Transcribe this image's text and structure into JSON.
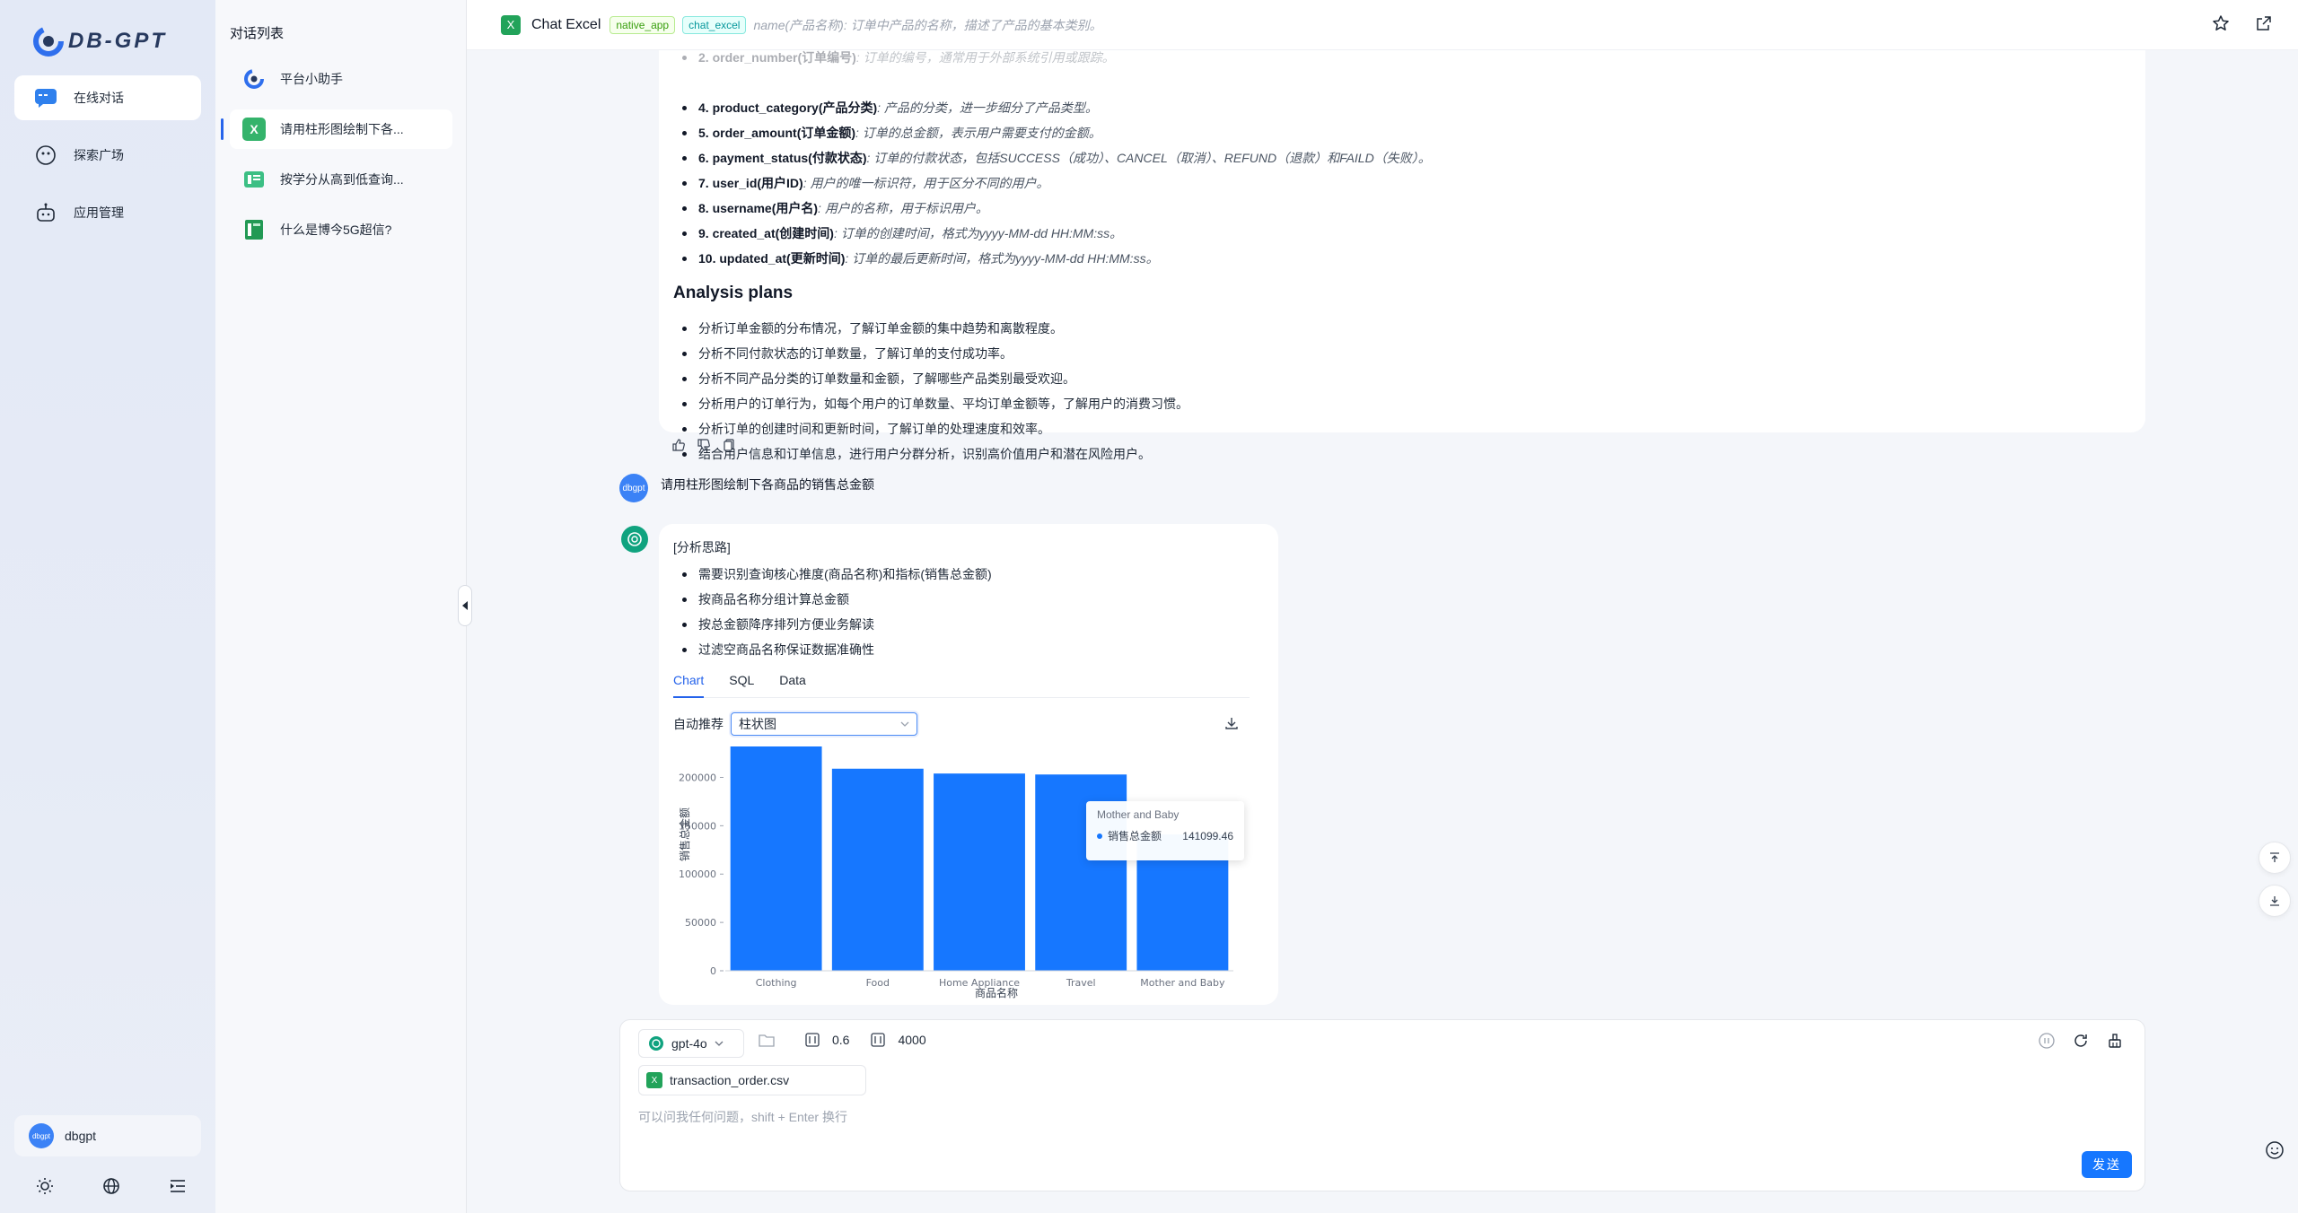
{
  "app": {
    "logo_text": "DB-GPT"
  },
  "rail": {
    "items": [
      {
        "label": "在线对话",
        "icon": "chat-icon",
        "active": true
      },
      {
        "label": "探索广场",
        "icon": "explore-icon",
        "active": false
      },
      {
        "label": "应用管理",
        "icon": "robot-icon",
        "active": false
      }
    ],
    "user": {
      "avatar_text": "dbgpt",
      "name": "dbgpt"
    },
    "tools": [
      "sun-icon",
      "globe-icon",
      "menu-fold-icon"
    ]
  },
  "convlist": {
    "title": "对话列表",
    "items": [
      {
        "label": "平台小助手",
        "icon": "dbgpt-logo-icon",
        "active": false
      },
      {
        "label": "请用柱形图绘制下各...",
        "icon": "excel-icon",
        "active": true
      },
      {
        "label": "按学分从高到低查询...",
        "icon": "database-icon",
        "active": false
      },
      {
        "label": "什么是博今5G超信?",
        "icon": "book-icon",
        "active": false
      }
    ]
  },
  "header": {
    "icon_text": "X",
    "title": "Chat Excel",
    "tags": [
      "native_app",
      "chat_excel"
    ],
    "ghost_text": "name(产品名称): 订单中产品的名称，描述了产品的基本类别。"
  },
  "msg1": {
    "fields": [
      {
        "key": "2. order_number(订单编号)",
        "desc": ": 订单的编号，通常用于外部系统引用或跟踪。",
        "faded": true
      },
      {
        "key": "4. product_category(产品分类)",
        "desc": ": 产品的分类，进一步细分了产品类型。",
        "faded": false
      },
      {
        "key": "5. order_amount(订单金额)",
        "desc": ": 订单的总金额，表示用户需要支付的金额。",
        "faded": false
      },
      {
        "key": "6. payment_status(付款状态)",
        "desc": ": 订单的付款状态，包括SUCCESS（成功）、CANCEL（取消）、REFUND（退款）和FAILD（失败）。",
        "faded": false
      },
      {
        "key": "7. user_id(用户ID)",
        "desc": ": 用户的唯一标识符，用于区分不同的用户。",
        "faded": false
      },
      {
        "key": "8. username(用户名)",
        "desc": ": 用户的名称，用于标识用户。",
        "faded": false
      },
      {
        "key": "9. created_at(创建时间)",
        "desc": ": 订单的创建时间，格式为yyyy-MM-dd HH:MM:ss。",
        "faded": false
      },
      {
        "key": "10. updated_at(更新时间)",
        "desc": ": 订单的最后更新时间，格式为yyyy-MM-dd HH:MM:ss。",
        "faded": false
      }
    ],
    "heading": "Analysis plans",
    "plans": [
      "分析订单金额的分布情况，了解订单金额的集中趋势和离散程度。",
      "分析不同付款状态的订单数量，了解订单的支付成功率。",
      "分析不同产品分类的订单数量和金额，了解哪些产品类别最受欢迎。",
      "分析用户的订单行为，如每个用户的订单数量、平均订单金额等，了解用户的消费习惯。",
      "分析订单的创建时间和更新时间，了解订单的处理速度和效率。",
      "结合用户信息和订单信息，进行用户分群分析，识别高价值用户和潜在风险用户。"
    ]
  },
  "user_message": {
    "avatar_text": "dbgpt",
    "text": "请用柱形图绘制下各商品的销售总金额"
  },
  "msg2": {
    "thinking_title": "[分析思路]",
    "thinking": [
      "需要识别查询核心推度(商品名称)和指标(销售总金额)",
      "按商品名称分组计算总金额",
      "按总金额降序排列方便业务解读",
      "过滤空商品名称保证数据准确性"
    ],
    "tabs": [
      "Chart",
      "SQL",
      "Data"
    ],
    "active_tab": "Chart",
    "recommend_label": "自动推荐",
    "chart_type_selected": "柱状图",
    "tooltip": {
      "title": "Mother and Baby",
      "series": "销售总金额",
      "value": "141099.46"
    }
  },
  "chart_data": {
    "type": "bar",
    "categories": [
      "Clothing",
      "Food",
      "Home Appliance",
      "Travel",
      "Mother and Baby"
    ],
    "series": [
      {
        "name": "销售总金额",
        "values": [
          232000,
          209000,
          204000,
          203000,
          141099.46
        ]
      }
    ],
    "xlabel": "商品名称",
    "ylabel": "销售总金额",
    "ylim": [
      0,
      232000
    ],
    "yticks": [
      0,
      50000,
      100000,
      150000,
      200000
    ],
    "color": "#1677ff",
    "grid": false
  },
  "input": {
    "model": "gpt-4o",
    "temperature": "0.6",
    "max_tokens": "4000",
    "file_name": "transaction_order.csv",
    "placeholder": "可以问我任何问题，shift + Enter 换行",
    "send_label": "发送"
  }
}
